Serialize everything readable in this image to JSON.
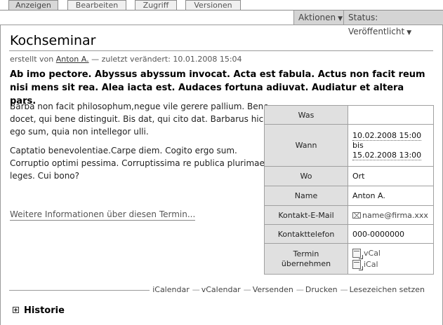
{
  "tabs": [
    {
      "label": "Anzeigen",
      "active": true
    },
    {
      "label": "Bearbeiten",
      "active": false
    },
    {
      "label": "Zugriff",
      "active": false
    },
    {
      "label": "Versionen",
      "active": false
    }
  ],
  "actionbar": {
    "actions_label": "Aktionen",
    "status_label": "Status: Veröffentlicht"
  },
  "page": {
    "title": "Kochseminar",
    "byline_prefix": "erstellt von",
    "author": "Anton A.",
    "byline_suffix": "— zuletzt verändert: 10.01.2008 15:04",
    "lead": "Ab imo pectore. Abyssus abyssum invocat. Acta est fabula. Actus non facit reum nisi mens sit rea. Alea iacta est. Audaces fortuna adiuvat. Audiatur et altera pars.",
    "paragraph1": "Barba non facit philosophum,negue vile gerere pallium. Bene docet, qui bene distinguit. Bis dat, qui cito dat. Barbarus hic ego sum, quia non intellegor ulli.",
    "paragraph2": "Captatio benevolentiae.Carpe diem. Cogito ergo sum. Corruptio optimi pessima. Corruptissima re publica plurimae leges. Cui bono?",
    "more_link": "Weitere Informationen über diesen Termin..."
  },
  "event": {
    "was_label": "Was",
    "was_value": "",
    "wann_label": "Wann",
    "start": "10.02.2008 15:00",
    "bis": "bis",
    "end": "15.02.2008 13:00",
    "wo_label": "Wo",
    "wo_value": "Ort",
    "name_label": "Name",
    "name_value": "Anton A.",
    "email_label": "Kontakt-E-Mail",
    "email_value": "name@firma.xxx",
    "phone_label": "Kontakttelefon",
    "phone_value": "000-0000000",
    "termin_label": "Termin übernehmen",
    "vcal": "vCal",
    "ical": "iCal"
  },
  "bottom_links": [
    "iCalendar",
    "vCalendar",
    "Versenden",
    "Drucken",
    "Lesezeichen setzen"
  ],
  "historie": "Historie"
}
